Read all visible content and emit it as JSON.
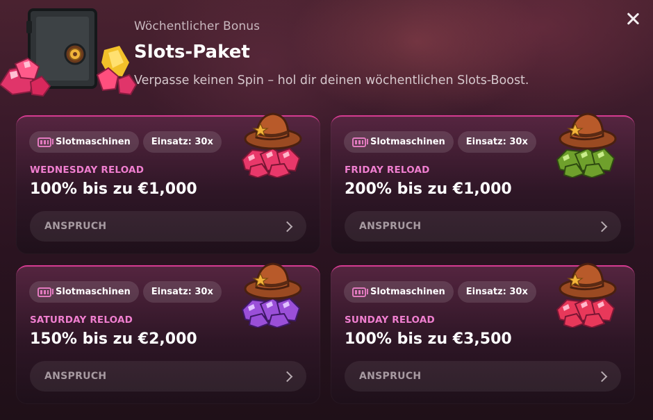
{
  "header": {
    "eyebrow": "Wöchentlicher Bonus",
    "title": "Slots-Paket",
    "subtitle": "Verpasse keinen Spin – hol dir deinen wöchentlichen Slots-Boost."
  },
  "cards": [
    {
      "tag_game": "Slotmaschinen",
      "tag_wager": "Einsatz: 30x",
      "name": "WEDNESDAY RELOAD",
      "offer": "100% bis zu €1,000",
      "claim": "ANSPRUCH",
      "gem_color": "#e8386a",
      "gem_icon": "ruby-gems-icon"
    },
    {
      "tag_game": "Slotmaschinen",
      "tag_wager": "Einsatz: 30x",
      "name": "FRIDAY RELOAD",
      "offer": "200% bis zu €1,000",
      "claim": "ANSPRUCH",
      "gem_color": "#7aa832",
      "gem_icon": "emerald-gems-icon"
    },
    {
      "tag_game": "Slotmaschinen",
      "tag_wager": "Einsatz: 30x",
      "name": "SATURDAY RELOAD",
      "offer": "150% bis zu €2,000",
      "claim": "ANSPRUCH",
      "gem_color": "#9a4fd8",
      "gem_icon": "amethyst-gems-icon"
    },
    {
      "tag_game": "Slotmaschinen",
      "tag_wager": "Einsatz: 30x",
      "name": "SUNDAY RELOAD",
      "offer": "100% bis zu €3,500",
      "claim": "ANSPRUCH",
      "gem_color": "#e8385a",
      "gem_icon": "ruby-gems-icon"
    }
  ],
  "colors": {
    "accent_pink": "#f07fd0",
    "card_border": "#d43a90"
  }
}
